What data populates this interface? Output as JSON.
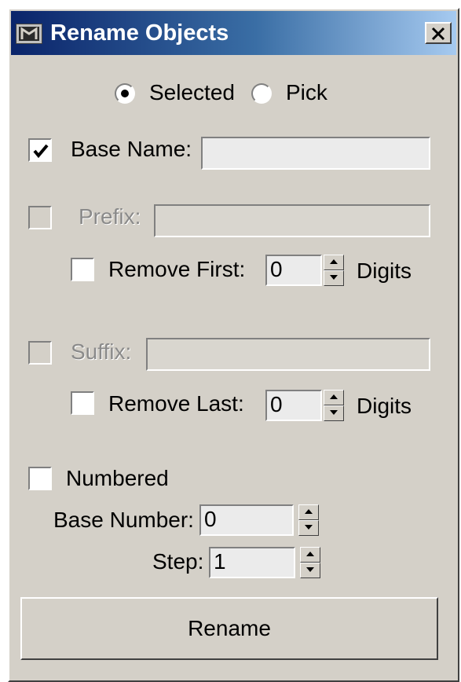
{
  "window": {
    "title": "Rename Objects"
  },
  "icons": {
    "app": "3dsmax-app-icon",
    "close": "close-icon",
    "check": "check-icon",
    "spin_up": "spin-up-arrow-icon",
    "spin_down": "spin-down-arrow-icon"
  },
  "mode": {
    "options": [
      "Selected",
      "Pick"
    ],
    "selected": "Selected"
  },
  "base_name": {
    "label": "Base Name:",
    "checked": true,
    "value": ""
  },
  "prefix": {
    "label": "Prefix:",
    "checked": false,
    "enabled": false,
    "value": ""
  },
  "remove_first": {
    "label": "Remove First:",
    "checked": false,
    "value": "0",
    "unit": "Digits"
  },
  "suffix": {
    "label": "Suffix:",
    "checked": false,
    "enabled": false,
    "value": ""
  },
  "remove_last": {
    "label": "Remove Last:",
    "checked": false,
    "value": "0",
    "unit": "Digits"
  },
  "numbered": {
    "label": "Numbered",
    "checked": false
  },
  "base_number": {
    "label": "Base Number:",
    "value": "0"
  },
  "step": {
    "label": "Step:",
    "value": "1"
  },
  "rename_button": {
    "label": "Rename"
  }
}
